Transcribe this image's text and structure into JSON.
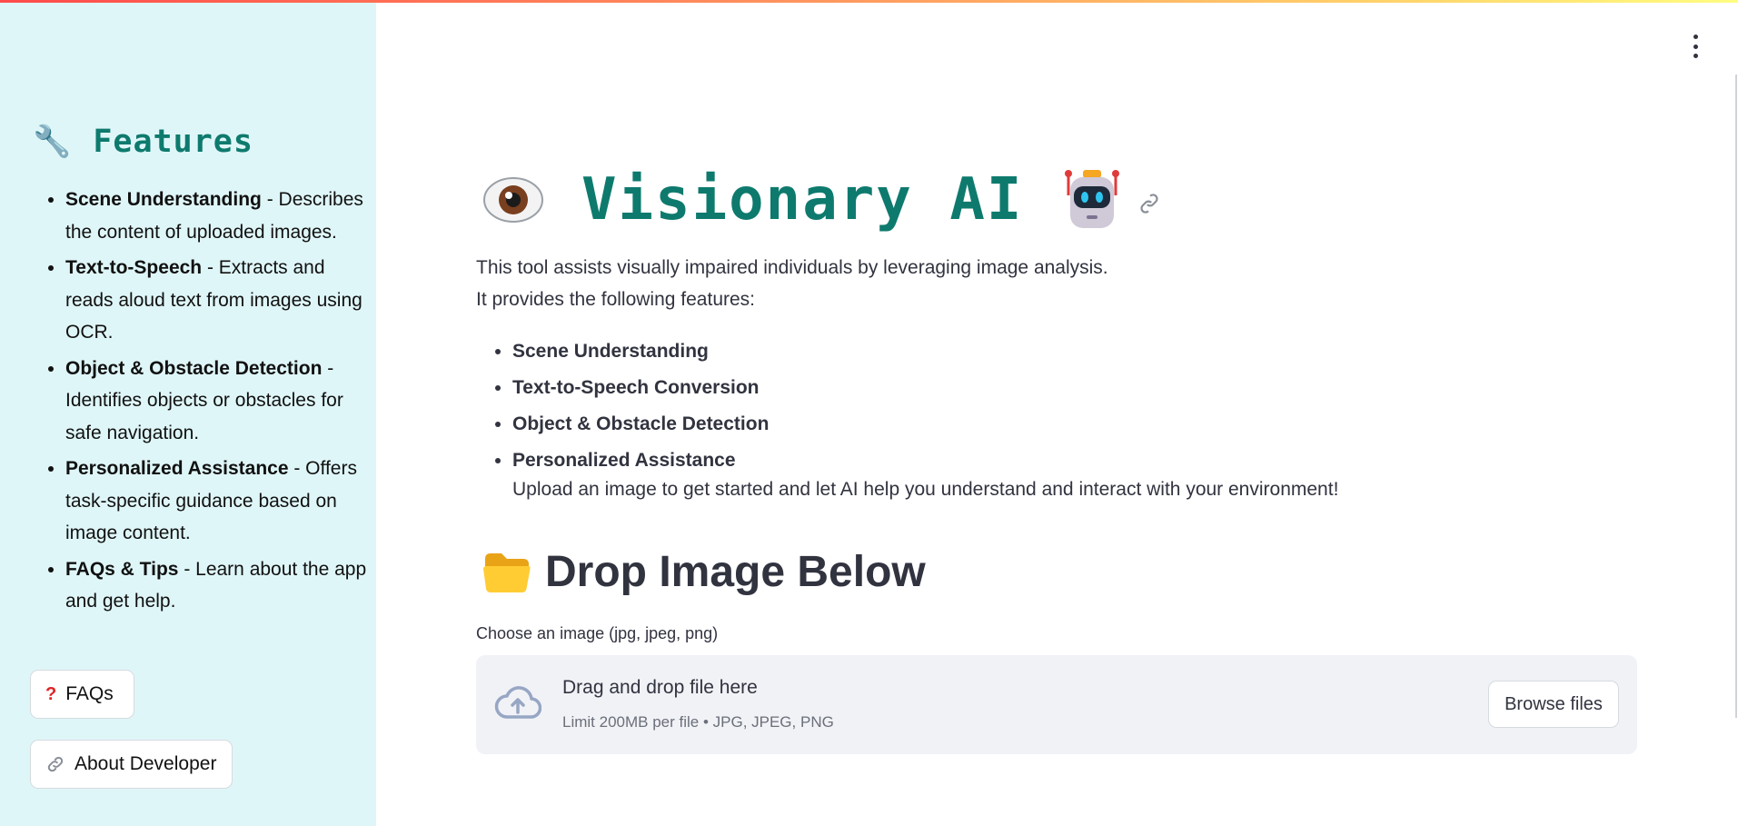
{
  "sidebar": {
    "title": "Features",
    "title_icon": "wrench-icon",
    "items": [
      {
        "title": "Scene Understanding",
        "desc": " - Describes the content of uploaded images."
      },
      {
        "title": "Text-to-Speech",
        "desc": " - Extracts and reads aloud text from images using OCR."
      },
      {
        "title": "Object & Obstacle Detection",
        "desc": " - Identifies objects or obstacles for safe navigation."
      },
      {
        "title": "Personalized Assistance",
        "desc": " - Offers task-specific guidance based on image content."
      },
      {
        "title": "FAQs & Tips",
        "desc": " - Learn about the app and get help."
      }
    ],
    "faq_button": "FAQs",
    "faq_icon": "question-mark-icon",
    "dev_button": "About Developer",
    "dev_icon": "link-icon"
  },
  "main": {
    "title": "Visionary AI",
    "title_left_icon": "eye-icon",
    "title_right_icon": "robot-icon",
    "intro_line1": "This tool assists visually impaired individuals by leveraging image analysis.",
    "intro_line2": "It provides the following features:",
    "features": [
      "Scene Understanding",
      "Text-to-Speech Conversion",
      "Object & Obstacle Detection",
      "Personalized Assistance"
    ],
    "cta": "Upload an image to get started and let AI help you understand and interact with your environment!",
    "drop_heading": "Drop Image Below",
    "drop_icon": "folder-icon"
  },
  "uploader": {
    "label": "Choose an image (jpg, jpeg, png)",
    "drag_text": "Drag and drop file here",
    "limit_text": "Limit 200MB per file • JPG, JPEG, PNG",
    "browse_label": "Browse files",
    "icon": "cloud-upload-icon"
  },
  "colors": {
    "accent": "#0e7a6e",
    "sidebar_bg": "#dff6f8",
    "text": "#31333f",
    "dropzone_bg": "#f0f2f6"
  }
}
